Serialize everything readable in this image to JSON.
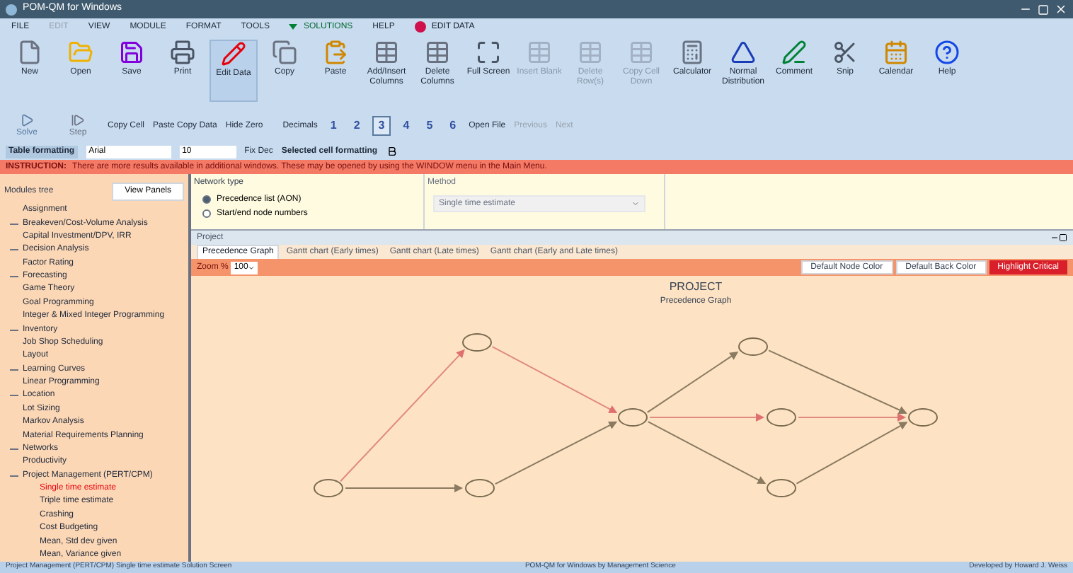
{
  "window": {
    "title": "POM-QM for Windows"
  },
  "menu": [
    {
      "label": "FILE",
      "kind": "plain"
    },
    {
      "label": "EDIT",
      "kind": "disabled"
    },
    {
      "label": "VIEW",
      "kind": "plain"
    },
    {
      "label": "MODULE",
      "kind": "plain"
    },
    {
      "label": "FORMAT",
      "kind": "plain"
    },
    {
      "label": "TOOLS",
      "kind": "plain"
    },
    {
      "label": "SOLUTIONS",
      "kind": "solutions"
    },
    {
      "label": "HELP",
      "kind": "plain"
    },
    {
      "label": "EDIT DATA",
      "kind": "edit"
    }
  ],
  "toolbar": [
    {
      "label": "New",
      "disabled": false
    },
    {
      "label": "Open",
      "disabled": false
    },
    {
      "label": "Save",
      "disabled": false
    },
    {
      "label": "Print",
      "disabled": false
    },
    {
      "label": "Edit Data",
      "disabled": false
    },
    {
      "label": "Copy",
      "disabled": false
    },
    {
      "label": "Paste",
      "disabled": false
    },
    {
      "label": "Add/Insert Columns",
      "disabled": false
    },
    {
      "label": "Delete Columns",
      "disabled": false
    },
    {
      "label": "Full Screen",
      "disabled": false
    },
    {
      "label": "Insert Blank",
      "disabled": true
    },
    {
      "label": "Delete Row(s)",
      "disabled": true
    },
    {
      "label": "Copy Cell Down",
      "disabled": true
    },
    {
      "label": "Calculator",
      "disabled": false
    },
    {
      "label": "Normal Distribution",
      "disabled": false
    },
    {
      "label": "Comment",
      "disabled": false
    },
    {
      "label": "Snip",
      "disabled": false
    },
    {
      "label": "Calendar",
      "disabled": false
    },
    {
      "label": "Help",
      "disabled": false
    }
  ],
  "toolbar2": {
    "solve": "Solve",
    "step": "Step",
    "copy_cell": "Copy Cell",
    "paste_copy": "Paste Copy Data",
    "hide_zero": "Hide Zero",
    "decimals_label": "Decimals",
    "decimals": [
      {
        "label": "1",
        "selected": false
      },
      {
        "label": "2",
        "selected": false
      },
      {
        "label": "3",
        "selected": true
      },
      {
        "label": "4",
        "selected": false
      },
      {
        "label": "5",
        "selected": false
      },
      {
        "label": "6",
        "selected": false
      }
    ],
    "open_file": "Open File",
    "previous": "Previous",
    "next": "Next"
  },
  "format_bar": {
    "label": "Table formatting",
    "font": "Arial",
    "size": "10",
    "fix_dec": "Fix Dec",
    "selected_label": "Selected cell formatting"
  },
  "instruction": {
    "label": "INSTRUCTION:",
    "text": "There are more results available in additional windows. These may be opened by using the WINDOW menu in the Main Menu."
  },
  "sidebar": {
    "title": "Modules tree",
    "button": "View Panels",
    "items": [
      {
        "label": "Assignment",
        "expandable": false,
        "selected": false
      },
      {
        "label": "Breakeven/Cost-Volume Analysis",
        "expandable": true,
        "selected": false
      },
      {
        "label": "Capital Investment/DPV, IRR",
        "expandable": false,
        "selected": false
      },
      {
        "label": "Decision Analysis",
        "expandable": true,
        "selected": false
      },
      {
        "label": "Factor Rating",
        "expandable": false,
        "selected": false
      },
      {
        "label": "Forecasting",
        "expandable": true,
        "selected": false
      },
      {
        "label": "Game Theory",
        "expandable": false,
        "selected": false
      },
      {
        "label": "Goal Programming",
        "expandable": false,
        "selected": false
      },
      {
        "label": "Integer & Mixed Integer Programming",
        "expandable": false,
        "selected": false
      },
      {
        "label": "Inventory",
        "expandable": true,
        "selected": false
      },
      {
        "label": "Job Shop Scheduling",
        "expandable": false,
        "selected": false
      },
      {
        "label": "Layout",
        "expandable": false,
        "selected": false
      },
      {
        "label": "Learning Curves",
        "expandable": true,
        "selected": false
      },
      {
        "label": "Linear Programming",
        "expandable": false,
        "selected": false
      },
      {
        "label": "Location",
        "expandable": true,
        "selected": false
      },
      {
        "label": "Lot Sizing",
        "expandable": false,
        "selected": false
      },
      {
        "label": "Markov Analysis",
        "expandable": false,
        "selected": false
      },
      {
        "label": "Material Requirements Planning",
        "expandable": false,
        "selected": false
      },
      {
        "label": "Networks",
        "expandable": true,
        "selected": false
      },
      {
        "label": "Productivity",
        "expandable": false,
        "selected": false
      },
      {
        "label": "Project Management (PERT/CPM)",
        "expandable": true,
        "selected": false,
        "children": [
          {
            "label": "Single time estimate",
            "selected": true
          },
          {
            "label": "Triple time estimate",
            "selected": false
          },
          {
            "label": "Crashing",
            "selected": false
          },
          {
            "label": "Cost Budgeting",
            "selected": false
          },
          {
            "label": "Mean, Std dev given",
            "selected": false
          },
          {
            "label": "Mean, Variance given",
            "selected": false
          }
        ]
      }
    ]
  },
  "network_type": {
    "title": "Network type",
    "options": [
      {
        "label": "Precedence list (AON)",
        "selected": true
      },
      {
        "label": "Start/end node numbers",
        "selected": false
      }
    ]
  },
  "method": {
    "title": "Method",
    "value": "Single time estimate"
  },
  "child_window": {
    "title": "Project",
    "tabs": [
      {
        "label": "Precedence Graph",
        "selected": true
      },
      {
        "label": "Gantt chart (Early times)",
        "selected": false
      },
      {
        "label": "Gantt chart (Late times)",
        "selected": false
      },
      {
        "label": "Gantt chart (Early and Late times)",
        "selected": false
      }
    ],
    "zoom_label": "Zoom %",
    "zoom_value": "100",
    "buttons": [
      {
        "label": "Default Node Color",
        "kind": "light"
      },
      {
        "label": "Default Back Color",
        "kind": "light"
      },
      {
        "label": "Highlight Critical",
        "kind": "red"
      }
    ],
    "graph_title": "PROJECT",
    "graph_subtitle": "Precedence Graph"
  },
  "status_bar": {
    "left": "Project Management (PERT/CPM) Single time estimate   Solution Screen",
    "center": "POM-QM for Windows by Management Science",
    "right": "Developed by Howard J. Weiss"
  }
}
